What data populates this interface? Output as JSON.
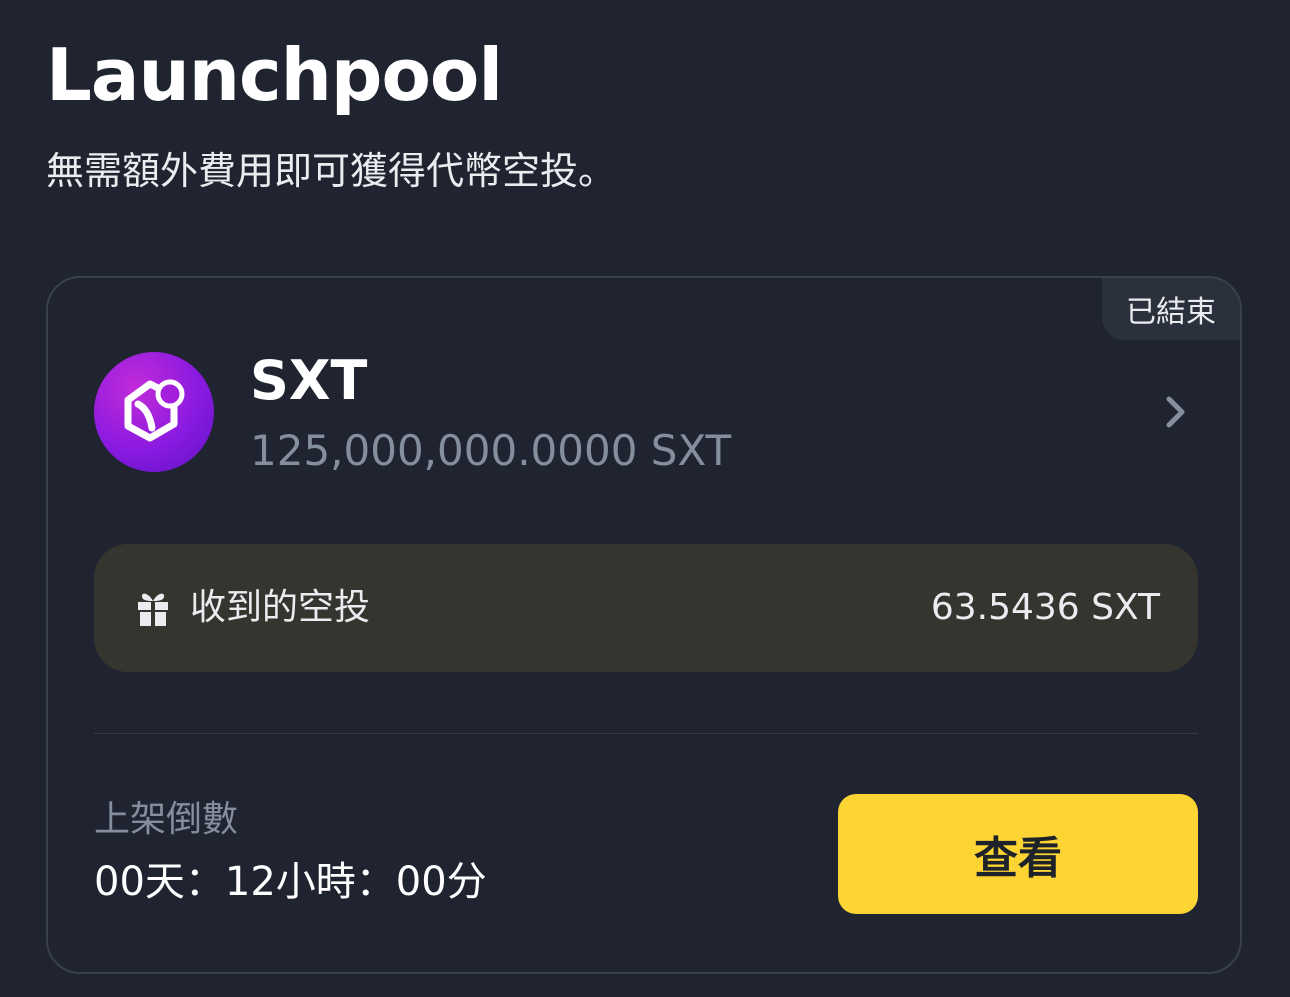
{
  "header": {
    "title": "Launchpool",
    "subtitle": "無需額外費用即可獲得代幣空投。"
  },
  "card": {
    "status_badge": "已結束",
    "token": {
      "name": "SXT",
      "amount": "125,000,000.0000 SXT",
      "logo_icon": "sxt-logo-icon",
      "chevron_icon": "chevron-right-icon"
    },
    "airdrop": {
      "icon": "gift-icon",
      "label": "收到的空投",
      "value": "63.5436 SXT"
    },
    "countdown": {
      "label": "上架倒數",
      "value": "00天：12小時：00分"
    },
    "view_button": "查看"
  },
  "colors": {
    "background": "#1f2430",
    "accent": "#fcd535",
    "muted_text": "#848e9c",
    "airdrop_box": "#353530"
  }
}
